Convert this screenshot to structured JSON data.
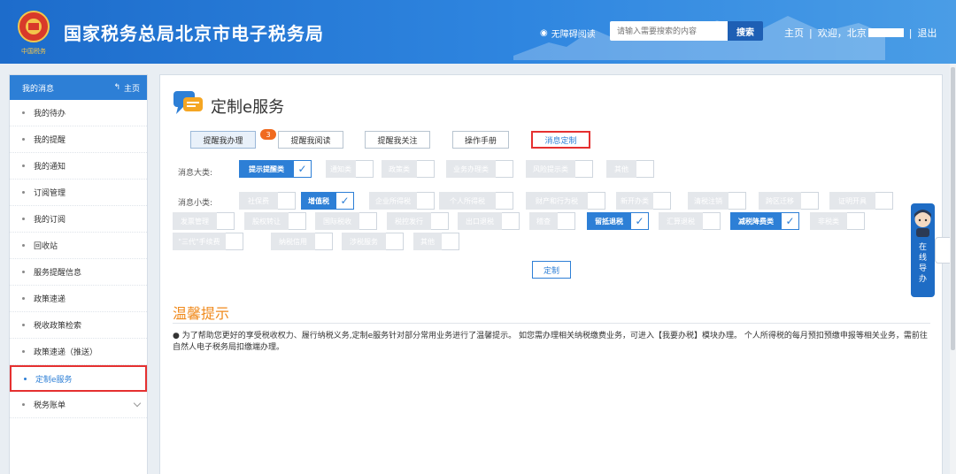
{
  "header": {
    "title": "国家税务总局北京市电子税务局",
    "logo_text": "中国税务",
    "accessibility_label": "无障碍阅读",
    "search_placeholder": "请输入需要搜索的内容",
    "search_button": "搜索",
    "home_link": "主页",
    "welcome": "欢迎，北京",
    "logout": "退出"
  },
  "sidebar": {
    "header": "我的消息",
    "home": "主页",
    "items": [
      {
        "label": "我的待办"
      },
      {
        "label": "我的提醒"
      },
      {
        "label": "我的通知"
      },
      {
        "label": "订阅管理"
      },
      {
        "label": "我的订阅"
      },
      {
        "label": "回收站"
      },
      {
        "label": "服务提醒信息"
      },
      {
        "label": "政策速递"
      },
      {
        "label": "税收政策检索"
      },
      {
        "label": "政策速递（推送）"
      },
      {
        "label": "定制e服务"
      },
      {
        "label": "税务账单"
      }
    ]
  },
  "main": {
    "title": "定制e服务",
    "tabs": [
      {
        "label": "提醒我办理"
      },
      {
        "label": "提醒我阅读"
      },
      {
        "label": "提醒我关注"
      },
      {
        "label": "操作手册"
      },
      {
        "label": "消息定制"
      }
    ],
    "badge_count": "3",
    "major_label": "消息大类:",
    "major_categories": [
      {
        "label": "提示提醒类",
        "checked": true
      },
      {
        "label": "通知类",
        "checked": false
      },
      {
        "label": "政策类",
        "checked": false
      },
      {
        "label": "业务办理类",
        "checked": false
      },
      {
        "label": "风险提示类",
        "checked": false
      },
      {
        "label": "其他",
        "checked": false
      }
    ],
    "minor_label": "消息小类:",
    "minor_categories": [
      {
        "label": "社保费",
        "checked": false
      },
      {
        "label": "增值税",
        "checked": true
      },
      {
        "label": "企业所得税",
        "checked": false
      },
      {
        "label": "个人所得税",
        "checked": false
      },
      {
        "label": "财产和行为税",
        "checked": false
      },
      {
        "label": "新开办类",
        "checked": false
      },
      {
        "label": "清税注销",
        "checked": false
      },
      {
        "label": "跨区迁移",
        "checked": false
      },
      {
        "label": "证明开具",
        "checked": false
      },
      {
        "label": "发票管理",
        "checked": false
      },
      {
        "label": "股权转让",
        "checked": false
      },
      {
        "label": "国际税收",
        "checked": false
      },
      {
        "label": "税控发行",
        "checked": false
      },
      {
        "label": "出口退税",
        "checked": false
      },
      {
        "label": "稽查",
        "checked": false
      },
      {
        "label": "留抵退税",
        "checked": true
      },
      {
        "label": "汇算退税",
        "checked": false
      },
      {
        "label": "减税降费类",
        "checked": true
      },
      {
        "label": "非税类",
        "checked": false
      },
      {
        "label": "\"三代\"手续费",
        "checked": false
      },
      {
        "label": "纳税信用",
        "checked": false
      },
      {
        "label": "涉税服务",
        "checked": false
      },
      {
        "label": "其他",
        "checked": false
      }
    ],
    "submit_label": "定制",
    "tip_title": "温馨提示",
    "tip_text": "● 为了帮助您更好的享受税收权力、履行纳税义务,定制e服务针对部分常用业务进行了温馨提示。 如您需办理相关纳税缴费业务，可进入【我要办税】模块办理。 个人所得税的每月预扣预缴申报等相关业务，需前往自然人电子税务局扣缴端办理。"
  },
  "helper": {
    "label_chars": [
      "在",
      "线",
      "导",
      "办"
    ]
  },
  "colors": {
    "header_blue": "#1d6ccb",
    "accent_blue": "#2d7fd6",
    "badge_orange": "#f06a1f",
    "tip_orange": "#f08a1c",
    "highlight_red": "#e53030"
  }
}
